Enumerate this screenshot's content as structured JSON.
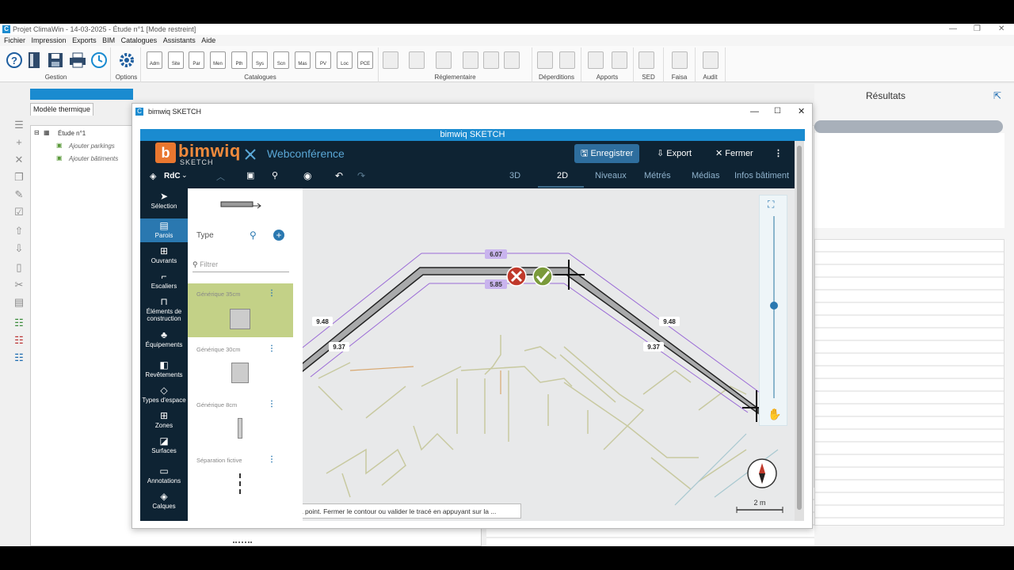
{
  "titlebar": {
    "title": "Projet ClimaWin - 14-03-2025 - Étude n°1 [Mode restreint]"
  },
  "menubar": [
    "Fichier",
    "Impression",
    "Exports",
    "BIM",
    "Catalogues",
    "Assistants",
    "Aide"
  ],
  "ribbon": {
    "groups": {
      "gestion": "Gestion",
      "options": "Options",
      "catalogues": "Catalogues",
      "reglementaire": "Réglementaire",
      "deperditions": "Déperditions",
      "apports": "Apports",
      "sed": "SED",
      "faisa": "Faisa",
      "audit": "Audit"
    },
    "catalogue_icons": [
      "Adm",
      "Site",
      "Par",
      "Men",
      "Pth",
      "Sys",
      "Scn",
      "Mas",
      "PV",
      "Loc",
      "PCE"
    ]
  },
  "left_panel": {
    "tab": "Modèle thermique",
    "tree": {
      "root": "Étude n°1",
      "children": [
        "Ajouter parkings",
        "Ajouter bâtiments"
      ]
    }
  },
  "results": {
    "title": "Résultats"
  },
  "sketch_window": {
    "title": "bimwiq SKETCH",
    "banner": "bimwiq SKETCH",
    "brand": {
      "name": "bimwiq",
      "sub": "SKETCH",
      "logo_letter": "b"
    },
    "webconf": "Webconférence",
    "buttons": {
      "save": "Enregistrer",
      "export": "Export",
      "close": "Fermer"
    },
    "level": "RdC",
    "nav_tabs": [
      "3D",
      "2D",
      "Niveaux",
      "Métrés",
      "Médias",
      "Infos bâtiment"
    ],
    "tools": [
      {
        "label": "Sélection",
        "icon": "cursor-icon"
      },
      {
        "label": "Parois",
        "icon": "wall-icon"
      },
      {
        "label": "Ouvrants",
        "icon": "window-icon"
      },
      {
        "label": "Escaliers",
        "icon": "stairs-icon"
      },
      {
        "label": "Éléments de construction",
        "icon": "construction-icon"
      },
      {
        "label": "Équipements",
        "icon": "equipment-icon"
      },
      {
        "label": "Revêtements",
        "icon": "coating-icon"
      },
      {
        "label": "Types d'espace",
        "icon": "tag-icon"
      },
      {
        "label": "Zones",
        "icon": "zones-icon"
      },
      {
        "label": "Surfaces",
        "icon": "surfaces-icon"
      },
      {
        "label": "Annotations",
        "icon": "comment-icon"
      },
      {
        "label": "Calques",
        "icon": "layers-icon"
      }
    ],
    "type_panel": {
      "type_label": "Type",
      "filter_placeholder": "Filtrer",
      "walls": [
        "Générique 35cm",
        "Générique 30cm",
        "Générique 8cm",
        "Séparation fictive"
      ]
    },
    "dimensions": {
      "top_outer": "6.07",
      "top_inner": "5.85",
      "left_outer": "9.48",
      "left_inner": "9.37",
      "right_outer": "9.48",
      "right_inner": "9.37"
    },
    "scale_label": "2 m",
    "status_message": "Cliquer pour tracer des murs point à point. Fermer le contour ou valider le tracé en appuyant sur la ..."
  },
  "colors": {
    "accent": "#1a8bd0",
    "brand": "#f08a3c",
    "dark_bg": "#0e2333",
    "selected": "#c3d187",
    "dimension": "#9a6ad6"
  }
}
